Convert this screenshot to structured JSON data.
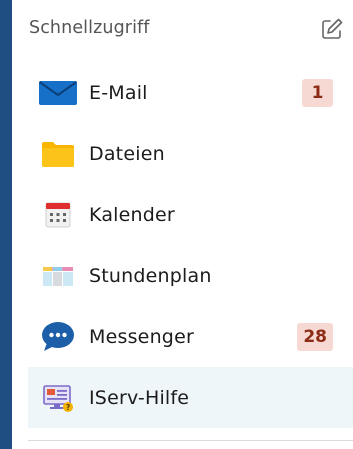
{
  "header": {
    "title": "Schnellzugriff",
    "edit_icon": "edit-pen-icon"
  },
  "items": [
    {
      "label": "E-Mail",
      "icon": "envelope-icon",
      "badge": "1"
    },
    {
      "label": "Dateien",
      "icon": "folder-icon",
      "badge": ""
    },
    {
      "label": "Kalender",
      "icon": "calendar-icon",
      "badge": ""
    },
    {
      "label": "Stundenplan",
      "icon": "timetable-icon",
      "badge": ""
    },
    {
      "label": "Messenger",
      "icon": "chat-bubble-icon",
      "badge": "28"
    },
    {
      "label": "IServ-Hilfe",
      "icon": "help-monitor-icon",
      "badge": ""
    }
  ],
  "colors": {
    "background": "#1f4e82",
    "panel": "#ffffff",
    "badge_bg": "#f7d9d3",
    "badge_text": "#8d2c16",
    "active_row": "#eef6fa",
    "mail_blue": "#1670c7",
    "folder_yellow": "#f9b500"
  }
}
